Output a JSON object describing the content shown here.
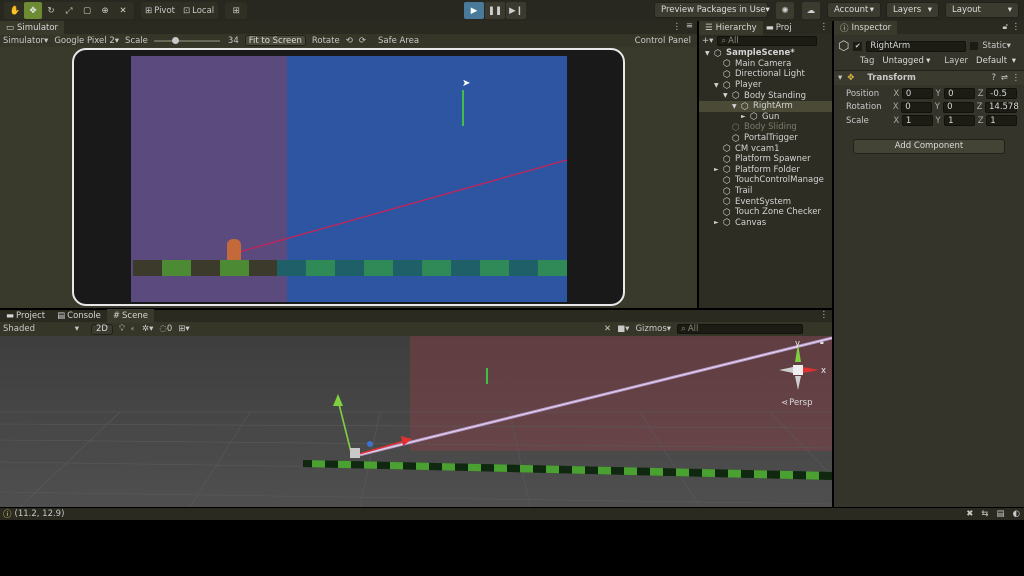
{
  "toolbar": {
    "pivot": "Pivot",
    "local": "Local",
    "preview_packages": "Preview Packages in Use",
    "account": "Account",
    "layers": "Layers",
    "layout": "Layout"
  },
  "simulator": {
    "tab": "Simulator",
    "mode": "Simulator",
    "device": "Google Pixel 2",
    "scale_label": "Scale",
    "scale_value": "34",
    "fit_to_screen": "Fit to Screen",
    "rotate": "Rotate",
    "safe_area": "Safe Area",
    "control_panel": "Control Panel"
  },
  "hierarchy": {
    "tab": "Hierarchy",
    "tab2": "Proj",
    "search_placeholder": "All",
    "items": [
      {
        "label": "SampleScene*",
        "indent": 0,
        "arrow": "▼",
        "bold": true
      },
      {
        "label": "Main Camera",
        "indent": 1,
        "arrow": ""
      },
      {
        "label": "Directional Light",
        "indent": 1,
        "arrow": ""
      },
      {
        "label": "Player",
        "indent": 1,
        "arrow": "▼"
      },
      {
        "label": "Body Standing",
        "indent": 2,
        "arrow": "▼"
      },
      {
        "label": "RightArm",
        "indent": 3,
        "arrow": "▼",
        "selected": true
      },
      {
        "label": "Gun",
        "indent": 4,
        "arrow": "►"
      },
      {
        "label": "Body Sliding",
        "indent": 2,
        "arrow": "",
        "dim": true
      },
      {
        "label": "PortalTrigger",
        "indent": 2,
        "arrow": ""
      },
      {
        "label": "CM vcam1",
        "indent": 1,
        "arrow": ""
      },
      {
        "label": "Platform Spawner",
        "indent": 1,
        "arrow": ""
      },
      {
        "label": "Platform Folder",
        "indent": 1,
        "arrow": "►"
      },
      {
        "label": "TouchControlManage",
        "indent": 1,
        "arrow": ""
      },
      {
        "label": "Trail",
        "indent": 1,
        "arrow": ""
      },
      {
        "label": "EventSystem",
        "indent": 1,
        "arrow": ""
      },
      {
        "label": "Touch Zone Checker",
        "indent": 1,
        "arrow": ""
      },
      {
        "label": "Canvas",
        "indent": 1,
        "arrow": "►"
      }
    ]
  },
  "inspector": {
    "tab": "Inspector",
    "object_name": "RightArm",
    "static_label": "Static",
    "tag_label": "Tag",
    "tag_value": "Untagged",
    "layer_label": "Layer",
    "layer_value": "Default",
    "transform_label": "Transform",
    "position_label": "Position",
    "rotation_label": "Rotation",
    "scale_label": "Scale",
    "x": "X",
    "y": "Y",
    "z": "Z",
    "position": {
      "x": "0",
      "y": "0",
      "z": "-0.5"
    },
    "rotation": {
      "x": "0",
      "y": "0",
      "z": "14.578"
    },
    "scale": {
      "x": "1",
      "y": "1",
      "z": "1"
    },
    "add_component": "Add Component"
  },
  "bottom_tabs": {
    "project": "Project",
    "console": "Console",
    "scene": "Scene"
  },
  "scene": {
    "shading": "Shaded",
    "mode_2d": "2D",
    "hidden_count": "0",
    "gizmos": "Gizmos",
    "search_placeholder": "All",
    "persp": "Persp",
    "axis_x": "x",
    "axis_y": "y"
  },
  "status": {
    "text": "(11.2, 12.9)"
  }
}
